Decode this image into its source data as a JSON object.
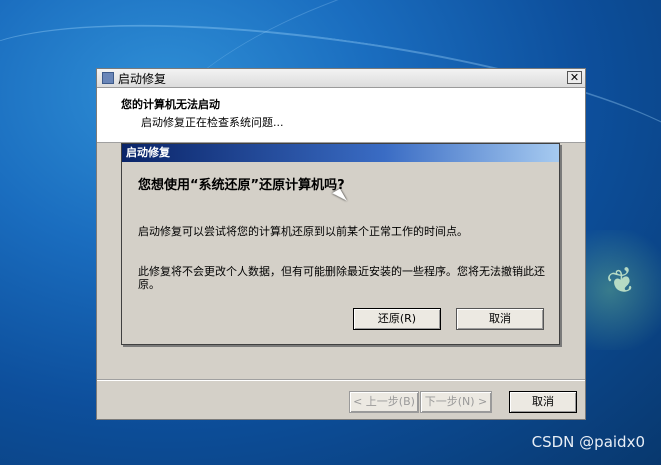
{
  "window": {
    "title": "启动修复",
    "close_glyph": "✕",
    "header_title": "您的计算机无法启动",
    "header_subtitle": "启动修复正在检查系统问题...",
    "prev_label": "< 上一步(B)",
    "next_label": "下一步(N) >",
    "cancel_label": "取消"
  },
  "dialog": {
    "title": "启动修复",
    "question": "您想使用“系统还原”还原计算机吗?",
    "paragraph1": "启动修复可以尝试将您的计算机还原到以前某个正常工作的时间点。",
    "paragraph2": "此修复将不会更改个人数据，但有可能删除最近安装的一些程序。您将无法撤销此还原。",
    "restore_label": "还原(R)",
    "cancel_label": "取消"
  },
  "watermark": "CSDN @paidx0",
  "icons": [
    "app-icon",
    "close-icon",
    "mouse-cursor-icon",
    "bird-logo-icon"
  ]
}
